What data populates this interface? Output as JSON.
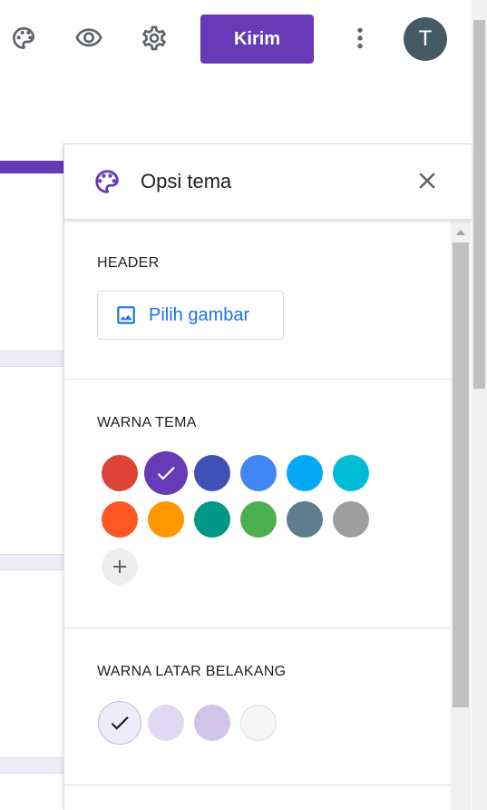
{
  "toolbar": {
    "icons": [
      "palette-icon",
      "eye-icon",
      "gear-icon",
      "more-vert-icon"
    ],
    "send_label": "Kirim",
    "avatar_initial": "T",
    "accent_color": "#673ab7",
    "avatar_color": "#455a64"
  },
  "panel": {
    "title": "Opsi tema",
    "header_section": {
      "label": "HEADER",
      "pick_image_label": "Pilih gambar"
    },
    "theme_color_section": {
      "label": "WARNA TEMA",
      "colors": [
        {
          "hex": "#db4437",
          "selected": false
        },
        {
          "hex": "#673ab7",
          "selected": true
        },
        {
          "hex": "#3f51b5",
          "selected": false
        },
        {
          "hex": "#4285f4",
          "selected": false
        },
        {
          "hex": "#03a9f4",
          "selected": false
        },
        {
          "hex": "#00bcd4",
          "selected": false
        },
        {
          "hex": "#ff5722",
          "selected": false
        },
        {
          "hex": "#ff9800",
          "selected": false
        },
        {
          "hex": "#009688",
          "selected": false
        },
        {
          "hex": "#4caf50",
          "selected": false
        },
        {
          "hex": "#607d8b",
          "selected": false
        },
        {
          "hex": "#9e9e9e",
          "selected": false
        }
      ]
    },
    "background_color_section": {
      "label": "WARNA LATAR BELAKANG",
      "colors": [
        {
          "hex": "#f0ebf8",
          "selected": true
        },
        {
          "hex": "#e1d8f1",
          "selected": false
        },
        {
          "hex": "#d1c4e9",
          "selected": false
        },
        {
          "hex": "#f6f6f6",
          "selected": false
        }
      ]
    }
  }
}
